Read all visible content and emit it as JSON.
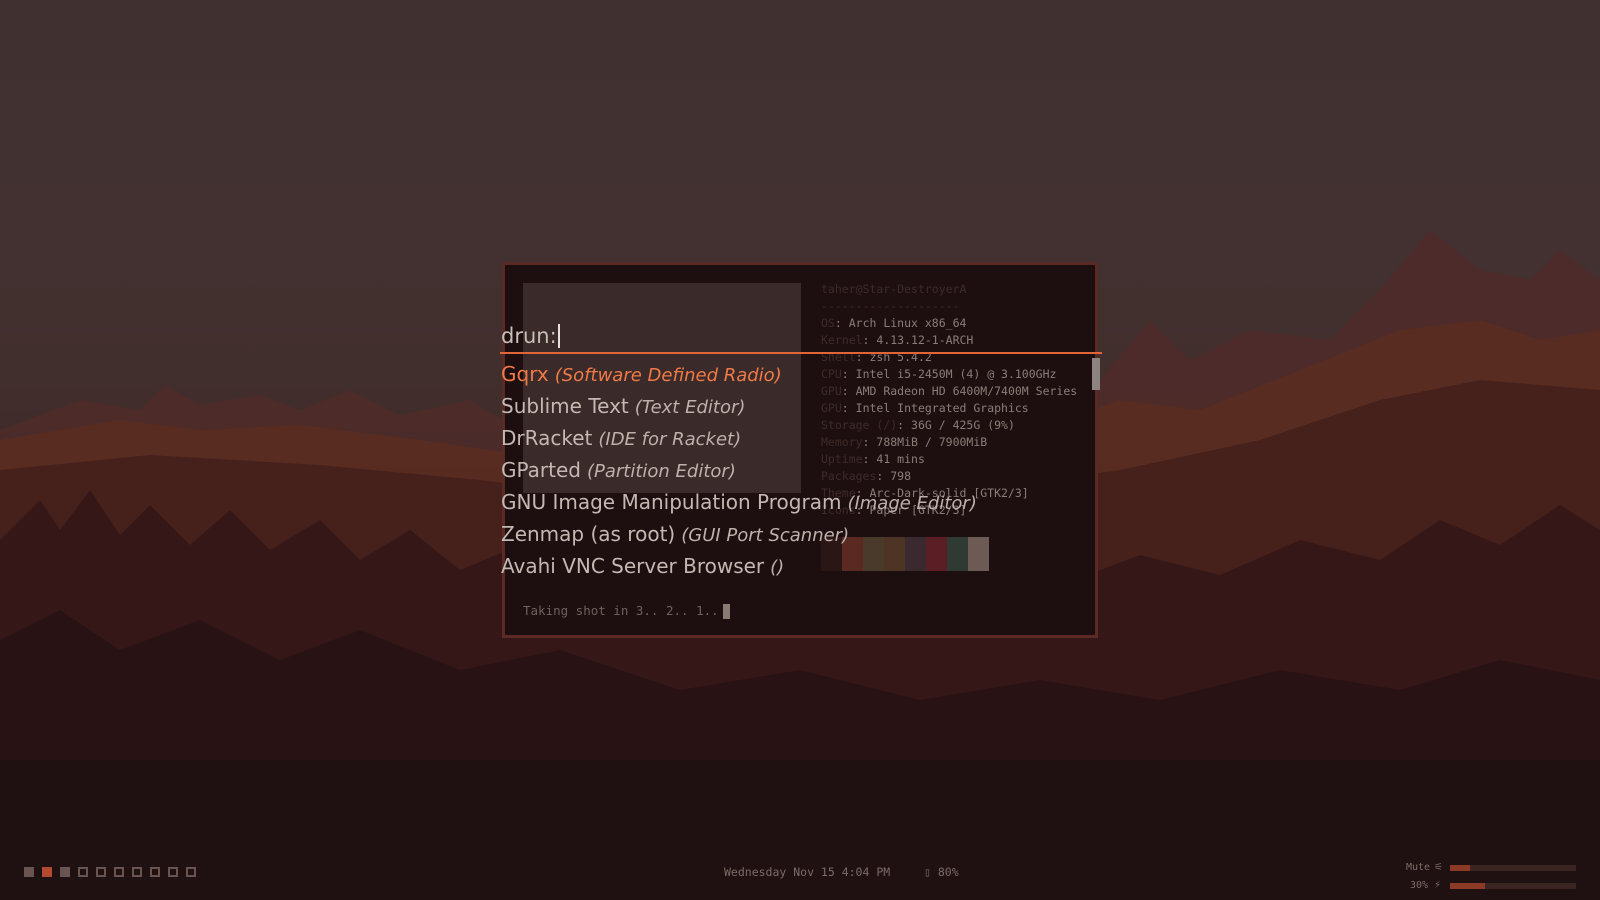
{
  "terminal": {
    "sysinfo_title": "taher@Star-DestroyerA",
    "sysinfo_separator": "--------------------",
    "sysinfo": [
      {
        "key": "OS",
        "value": "Arch Linux x86_64"
      },
      {
        "key": "Kernel",
        "value": "4.13.12-1-ARCH"
      },
      {
        "key": "Shell",
        "value": "zsh 5.4.2"
      },
      {
        "key": "CPU",
        "value": "Intel i5-2450M (4) @ 3.100GHz"
      },
      {
        "key": "GPU",
        "value": "AMD Radeon HD 6400M/7400M Series"
      },
      {
        "key": "GPU",
        "value": "Intel Integrated Graphics"
      },
      {
        "key": "Storage (/)",
        "value": "36G / 425G (9%)"
      },
      {
        "key": "Memory",
        "value": "788MiB / 7900MiB"
      },
      {
        "key": "Uptime",
        "value": "41 mins"
      },
      {
        "key": "Packages",
        "value": "798"
      },
      {
        "key": "Theme",
        "value": "Arc-Dark-solid [GTK2/3]"
      },
      {
        "key": "Icons",
        "value": "Paper [GTK2/3]"
      }
    ],
    "palette": [
      "#2a1614",
      "#5a2a22",
      "#4a3a2c",
      "#4e3424",
      "#3a2a30",
      "#5a1e24",
      "#2e3a32",
      "#6e5a54"
    ],
    "command_line": "Taking shot in 3.. 2.. 1.."
  },
  "launcher": {
    "prompt": "drun:",
    "items": [
      {
        "name": "Gqrx",
        "generic": "(Software Defined Radio)",
        "selected": true
      },
      {
        "name": "Sublime Text",
        "generic": "(Text Editor)"
      },
      {
        "name": "DrRacket",
        "generic": "(IDE for Racket)"
      },
      {
        "name": "GParted",
        "generic": "(Partition Editor)"
      },
      {
        "name": "GNU Image Manipulation Program",
        "generic": "(Image Editor)"
      },
      {
        "name": "Zenmap (as root)",
        "generic": "(GUI Port Scanner)"
      },
      {
        "name": "Avahi VNC Server Browser",
        "generic": "()"
      }
    ],
    "accent_color": "#f07a47"
  },
  "bar": {
    "workspaces": [
      "filled",
      "active",
      "filled",
      "empty",
      "empty",
      "empty",
      "empty",
      "empty",
      "empty",
      "empty"
    ],
    "clock": "Wednesday Nov 15  4:04 PM",
    "battery_icon": "battery-icon",
    "battery": "80%",
    "volume_label": "Mute",
    "volume_icon": "speaker-muted-icon",
    "volume_level": 0.16,
    "brightness_label": "30%",
    "brightness_icon": "lightning-icon",
    "brightness_level": 0.28
  }
}
